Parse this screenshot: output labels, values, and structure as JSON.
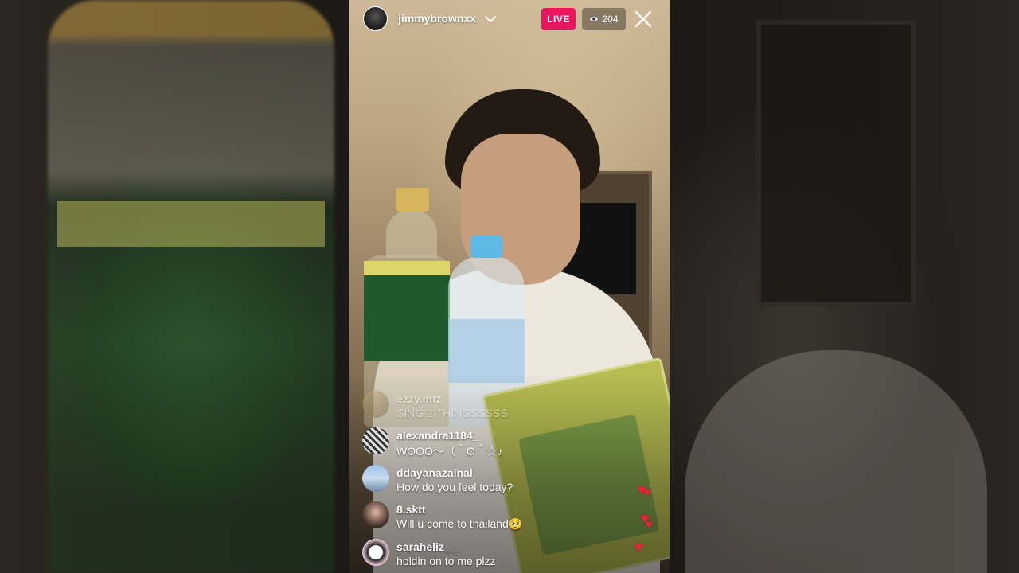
{
  "host": {
    "username": "jimmybrownxx"
  },
  "live_badge": "LIVE",
  "viewer_count": "204",
  "comments": [
    {
      "username": "ezzy.mtz",
      "message": "SING 2 THINGSSSSS"
    },
    {
      "username": "alexandra1184_",
      "message": "WOOO～（＾O＾☆♪"
    },
    {
      "username": "ddayanazainal",
      "message": "How do you feel today?"
    },
    {
      "username": "8.sktt",
      "message": "Will u come to thailand🥺"
    },
    {
      "username": "saraheliz__",
      "message": "holdin on to me plzz"
    }
  ],
  "colors": {
    "live_badge": "#e8175d",
    "heart": "#e2263c"
  },
  "icons": {
    "chevron": "chevron-down-icon",
    "eye": "eye-icon",
    "close": "close-icon",
    "heart": "heart-icon"
  }
}
